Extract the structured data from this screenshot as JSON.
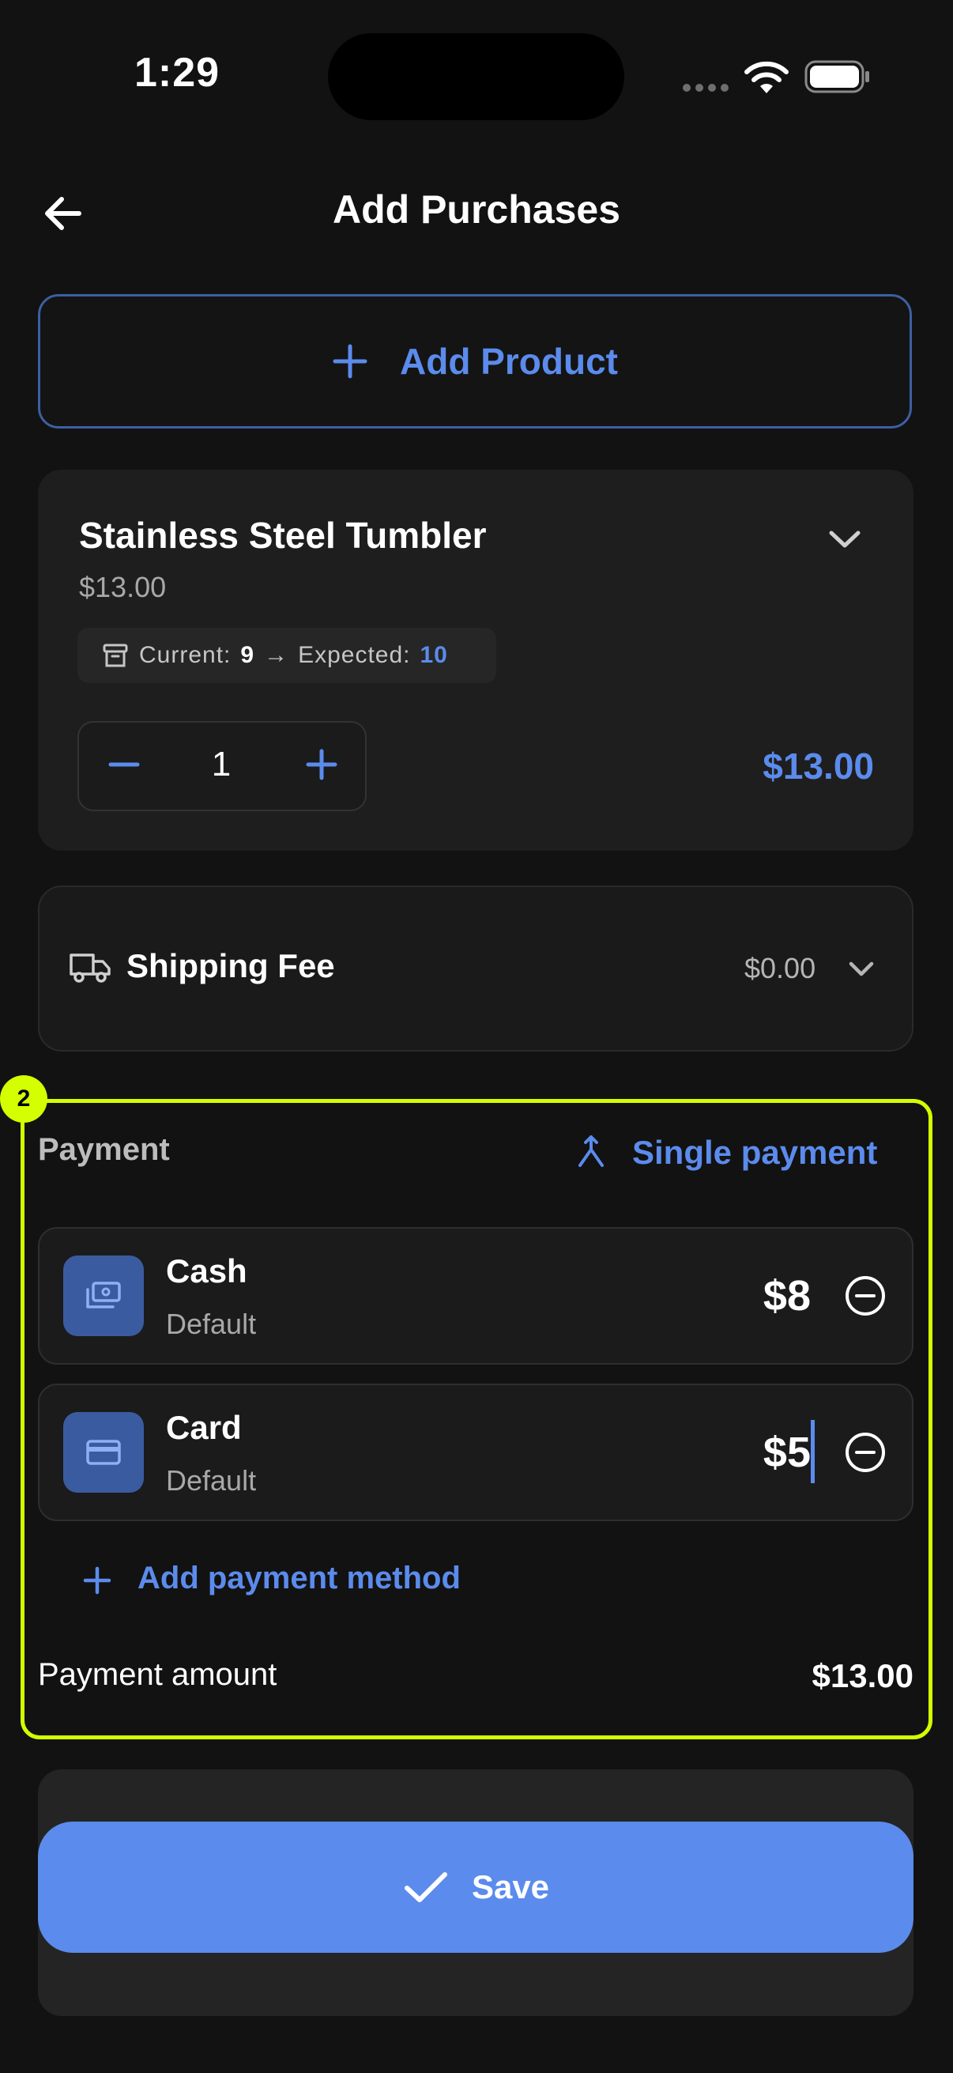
{
  "status_bar": {
    "time": "1:29"
  },
  "header": {
    "title": "Add Purchases",
    "back_icon": "arrow-left-icon"
  },
  "add_product": {
    "label": "Add Product"
  },
  "product": {
    "name": "Stainless Steel Tumbler",
    "price": "$13.00",
    "stock_current_label": "Current:",
    "stock_current": "9",
    "stock_arrow": "→",
    "stock_expected_label": "Expected:",
    "stock_expected": "10",
    "quantity": "1",
    "line_total": "$13.00"
  },
  "shipping": {
    "label": "Shipping Fee",
    "value": "$0.00"
  },
  "payment": {
    "badge": "2",
    "label": "Payment",
    "single_payment_label": "Single payment",
    "methods": [
      {
        "name": "Cash",
        "subtitle": "Default",
        "amount": "$8",
        "icon": "cash-icon"
      },
      {
        "name": "Card",
        "subtitle": "Default",
        "amount": "$5",
        "icon": "credit-card-icon"
      }
    ],
    "add_method_label": "Add payment method",
    "amount_label": "Payment amount",
    "amount_value": "$13.00"
  },
  "save": {
    "label": "Save"
  },
  "colors": {
    "accent": "#5b8bec",
    "highlight": "#d4ff00",
    "background": "#121212"
  }
}
